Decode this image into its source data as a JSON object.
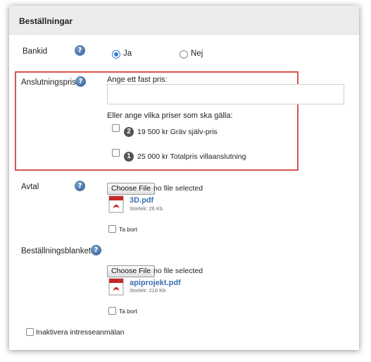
{
  "header": {
    "title": "Beställningar"
  },
  "bankid": {
    "label": "Bankid",
    "yes": "Ja",
    "no": "Nej",
    "selected": "Ja"
  },
  "anslutningspris": {
    "label": "Anslutningspris",
    "fixed_price_label": "Ange ett fast pris:",
    "fixed_price_value": "",
    "prices_label": "Eller ange vilka priser som ska gälla:",
    "options": [
      {
        "badge": "2",
        "text": "19 500 kr Gräv själv-pris"
      },
      {
        "badge": "1",
        "text": "25 000 kr Totalpris villaanslutning"
      }
    ]
  },
  "avtal": {
    "label": "Avtal",
    "choose_file": "Choose File",
    "no_file": "no file selected",
    "file_name": "3D.pdf",
    "file_size": "Storlek: 26 Kb",
    "remove_label": "Ta bort"
  },
  "bestallningsblankett": {
    "label": "Beställningsblankett",
    "choose_file": "Choose File",
    "no_file": "no file selected",
    "file_name": "apiprojekt.pdf",
    "file_size": "Storlek: 216 Kb",
    "remove_label": "Ta bort"
  },
  "inaktivera": {
    "label": "Inaktivera intresseanmälan"
  },
  "icons": {
    "help": "help-icon",
    "pdf": "pdf-icon"
  },
  "colors": {
    "accent": "#3a7bd5",
    "highlight_border": "#d9534f",
    "link": "#3a6fb0"
  }
}
